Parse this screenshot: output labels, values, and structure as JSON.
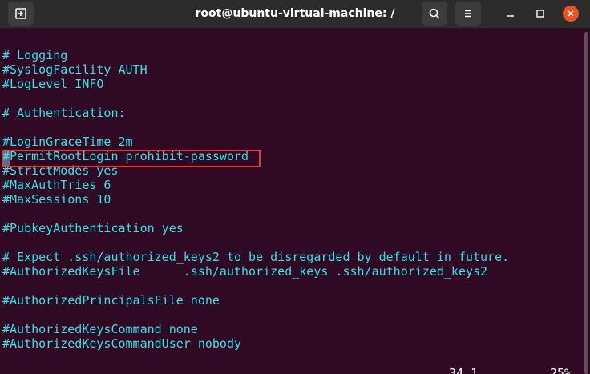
{
  "window": {
    "title": "root@ubuntu-virtual-machine: /",
    "new_tab_icon": "new-tab-icon",
    "search_icon": "search-icon",
    "menu_icon": "hamburger-menu-icon",
    "minimize_icon": "minimize-icon",
    "maximize_icon": "maximize-icon",
    "close_icon": "close-icon"
  },
  "colors": {
    "terminal_bg": "#300a24",
    "comment_text": "#34e2e2",
    "highlight_box": "#e03a3a",
    "close_button": "#e95420"
  },
  "lines": [
    "# Logging",
    "#SyslogFacility AUTH",
    "#LogLevel INFO",
    "",
    "# Authentication:",
    "",
    "#LoginGraceTime 2m",
    "#PermitRootLogin prohibit-password",
    "#StrictModes yes",
    "#MaxAuthTries 6",
    "#MaxSessions 10",
    "",
    "#PubkeyAuthentication yes",
    "",
    "# Expect .ssh/authorized_keys2 to be disregarded by default in future.",
    "#AuthorizedKeysFile      .ssh/authorized_keys .ssh/authorized_keys2",
    "",
    "#AuthorizedPrincipalsFile none",
    "",
    "#AuthorizedKeysCommand none",
    "#AuthorizedKeysCommandUser nobody"
  ],
  "status": {
    "position": "34,1",
    "percent": "25%"
  }
}
